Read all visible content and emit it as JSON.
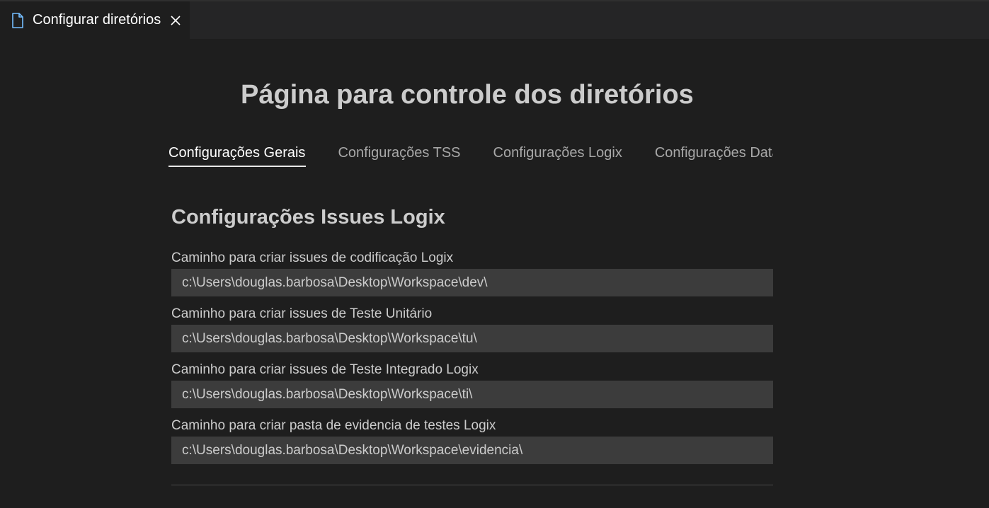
{
  "editor": {
    "tab_title": "Configurar diretórios",
    "tab_icon": "file-icon",
    "close_icon": "close-icon",
    "accent_color": "#75beff"
  },
  "page": {
    "title": "Página para controle dos diretórios"
  },
  "tabs": [
    {
      "label": "Configurações Gerais",
      "active": true
    },
    {
      "label": "Configurações TSS",
      "active": false
    },
    {
      "label": "Configurações Logix",
      "active": false
    },
    {
      "label": "Configurações Datasul",
      "active": false
    }
  ],
  "section": {
    "title": "Configurações Issues Logix",
    "fields": [
      {
        "label": "Caminho para criar issues de codificação Logix",
        "value": "c:\\Users\\douglas.barbosa\\Desktop\\Workspace\\dev\\"
      },
      {
        "label": "Caminho para criar issues de Teste Unitário",
        "value": "c:\\Users\\douglas.barbosa\\Desktop\\Workspace\\tu\\"
      },
      {
        "label": "Caminho para criar issues de Teste Integrado Logix",
        "value": "c:\\Users\\douglas.barbosa\\Desktop\\Workspace\\ti\\"
      },
      {
        "label": "Caminho para criar pasta de evidencia de testes Logix",
        "value": "c:\\Users\\douglas.barbosa\\Desktop\\Workspace\\evidencia\\"
      }
    ]
  }
}
